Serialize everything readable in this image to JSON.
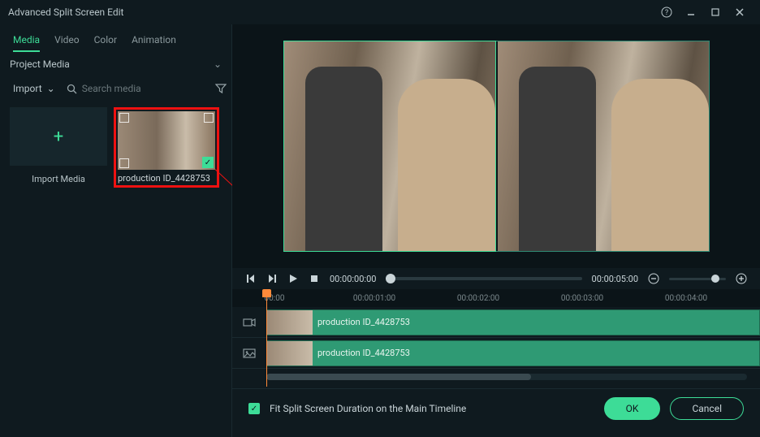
{
  "window": {
    "title": "Advanced Split Screen Edit"
  },
  "tabs": {
    "media": "Media",
    "video": "Video",
    "color": "Color",
    "animation": "Animation"
  },
  "projectMedia": {
    "label": "Project Media"
  },
  "import": {
    "button": "Import",
    "tileLabel": "Import Media",
    "searchPlaceholder": "Search media"
  },
  "mediaItem": {
    "name": "production ID_4428753"
  },
  "playback": {
    "currentTime": "00:00:00:00",
    "totalTime": "00:00:05:00"
  },
  "ruler": {
    "t0": "00:00",
    "t1": "00:00:01:00",
    "t2": "00:00:02:00",
    "t3": "00:00:03:00",
    "t4": "00:00:04:00"
  },
  "clip1": {
    "name": "production ID_4428753"
  },
  "clip2": {
    "name": "production ID_4428753"
  },
  "footer": {
    "fitLabel": "Fit Split Screen Duration on the Main Timeline",
    "ok": "OK",
    "cancel": "Cancel"
  }
}
